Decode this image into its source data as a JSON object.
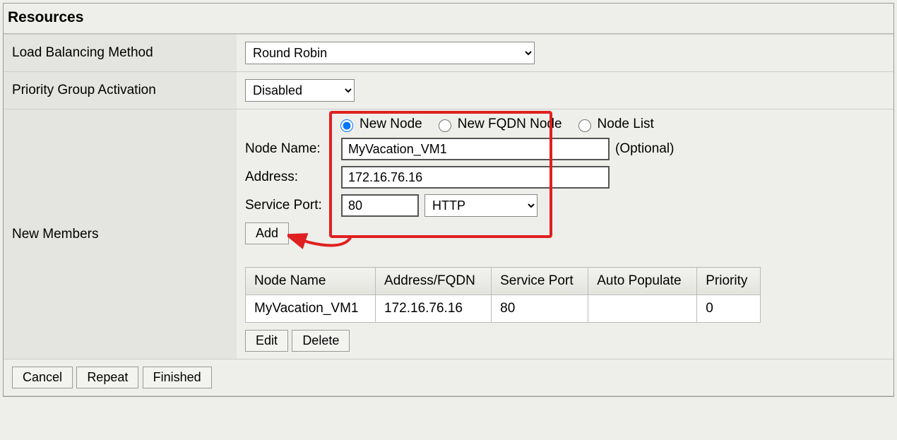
{
  "section_title": "Resources",
  "rows": {
    "lb_method_label": "Load Balancing Method",
    "lb_method_value": "Round Robin",
    "priority_label": "Priority Group Activation",
    "priority_value": "Disabled",
    "new_members_label": "New Members"
  },
  "node_type": {
    "new_node": "New Node",
    "new_fqdn_node": "New FQDN Node",
    "node_list": "Node List",
    "selected": "new_node"
  },
  "node_form": {
    "node_name_label": "Node Name:",
    "node_name_value": "MyVacation_VM1",
    "node_name_optional": "(Optional)",
    "address_label": "Address:",
    "address_value": "172.16.76.16",
    "service_port_label": "Service Port:",
    "service_port_value": "80",
    "service_port_proto": "HTTP"
  },
  "buttons": {
    "add": "Add",
    "edit": "Edit",
    "delete": "Delete",
    "cancel": "Cancel",
    "repeat": "Repeat",
    "finished": "Finished"
  },
  "members_table": {
    "headers": {
      "node_name": "Node Name",
      "address": "Address/FQDN",
      "service_port": "Service Port",
      "auto_populate": "Auto Populate",
      "priority": "Priority"
    },
    "rows": [
      {
        "node_name": "MyVacation_VM1",
        "address": "172.16.76.16",
        "service_port": "80",
        "auto_populate": "",
        "priority": "0"
      }
    ]
  }
}
